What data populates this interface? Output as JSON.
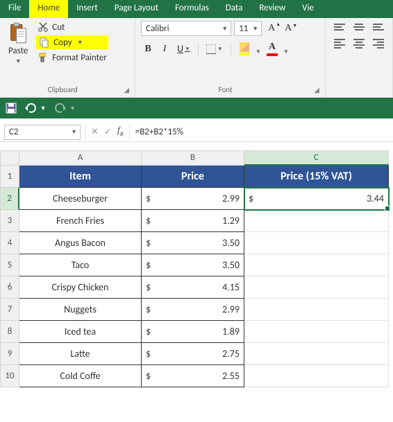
{
  "tabs": {
    "file": "File",
    "home": "Home",
    "insert": "Insert",
    "pagelayout": "Page Layout",
    "formulas": "Formulas",
    "data": "Data",
    "review": "Review",
    "view": "Vie"
  },
  "ribbon": {
    "clipboard": {
      "paste": "Paste",
      "cut": "Cut",
      "copy": "Copy",
      "fpainter": "Format Painter",
      "label": "Clipboard"
    },
    "font": {
      "name": "Calibri",
      "size": "11",
      "bold": "B",
      "italic": "I",
      "underline": "U",
      "fontcolor_a": "A",
      "sizeup_a": "A",
      "sizedown_a": "A",
      "label": "Font"
    }
  },
  "namebox": "C2",
  "formula": "=B2+B2*15%",
  "headers": {
    "A": "Item",
    "B": "Price",
    "C": "Price (15% VAT)"
  },
  "cols": {
    "A": "A",
    "B": "B",
    "C": "C"
  },
  "rows": [
    {
      "n": "1"
    },
    {
      "n": "2",
      "item": "Cheeseburger",
      "cur": "$",
      "price": "2.99",
      "vcur": "$",
      "vprice": "3.44"
    },
    {
      "n": "3",
      "item": "French Fries",
      "cur": "$",
      "price": "1.29"
    },
    {
      "n": "4",
      "item": "Angus Bacon",
      "cur": "$",
      "price": "3.50"
    },
    {
      "n": "5",
      "item": "Taco",
      "cur": "$",
      "price": "3.50"
    },
    {
      "n": "6",
      "item": "Crispy Chicken",
      "cur": "$",
      "price": "4.15"
    },
    {
      "n": "7",
      "item": "Nuggets",
      "cur": "$",
      "price": "2.99"
    },
    {
      "n": "8",
      "item": "Iced tea",
      "cur": "$",
      "price": "1.89"
    },
    {
      "n": "9",
      "item": "Latte",
      "cur": "$",
      "price": "2.75"
    },
    {
      "n": "10",
      "item": "Cold Coffe",
      "cur": "$",
      "price": "2.55"
    }
  ]
}
